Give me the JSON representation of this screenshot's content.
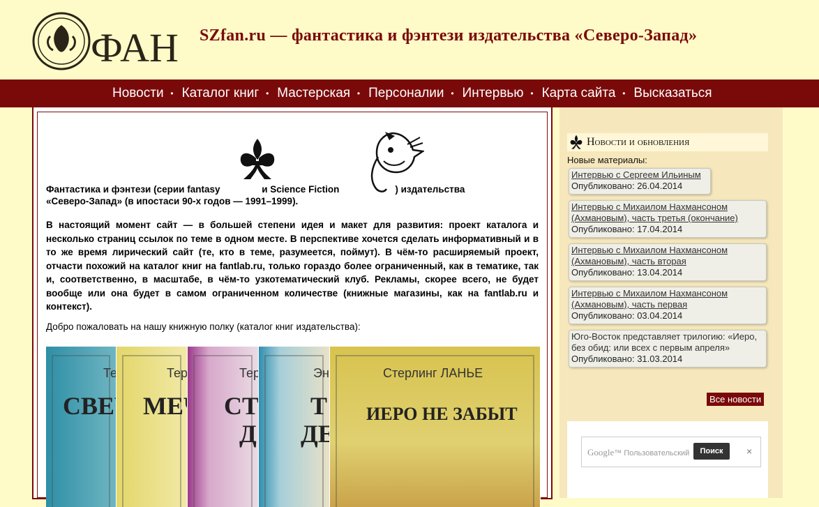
{
  "header": {
    "logo_text": "ФАН",
    "title": "SZfan.ru — фантастика и фэнтези издательства «Северо-Запад»"
  },
  "nav": {
    "items": [
      "Новости",
      "Каталог книг",
      "Мастерская",
      "Персоналии",
      "Интервью",
      "Карта сайта",
      "Высказаться"
    ]
  },
  "main": {
    "intro_part1": "Фантастика и фэнтези (серии fantasy",
    "intro_part2": "и Science Fiction",
    "intro_part3": ") издательства",
    "intro_part4": "«Северо-Запад» (в ипостаси 90-х годов — 1991–1999).",
    "paragraph": "В настоящий момент сайт — в большей степени идея и макет для развития: проект каталога и несколько страниц ссылок по теме в одном месте. В перспективе хочется сделать информативный и в то же время лирический сайт (те, кто в теме, разумеется, поймут). В чём-то расширяемый проект, отчасти похожий на каталог книг на fantlab.ru, только гораздо более ограниченный, как в тематике, так и, соответственно, в масштабе, в чём-то узкотематический клуб. Рекламы, скорее всего, не будет вообще или она будет в самом ограниченном количестве (книжные магазины, как на fantlab.ru и контекст).",
    "welcome": "Добро пожаловать на нашу книжную полку (каталог книг издательства):",
    "books": [
      {
        "author": "Тер",
        "title": "СВЕЧ",
        "bg": "#2e8fa6"
      },
      {
        "author": "Тер",
        "title": "МЕЧ",
        "bg": "#e3d66a"
      },
      {
        "author": "Тер",
        "title": "СТЕ",
        "title2": "Д",
        "bg": "#9b3a8c"
      },
      {
        "author": "Энн",
        "title": "Т",
        "title2": "ДЕ",
        "bg": "#2f8fb0"
      },
      {
        "author": "Стерлинг ЛАНЬЕ",
        "title": "ИЕРО НЕ ЗАБЫТ",
        "bg": "#d8c34f"
      }
    ]
  },
  "sidebar": {
    "news_title": "Новости и обновления",
    "new_materials_label": "Новые материалы:",
    "news": [
      {
        "link": "Интервью с Сергеем Ильиным",
        "date": "Опубликовано: 26.04.2014"
      },
      {
        "link": "Интервью с Михаилом Нахмансоном (Ахмановым), часть третья (окончание)",
        "date": "Опубликовано: 17.04.2014"
      },
      {
        "link": "Интервью с Михаилом Нахмансоном (Ахмановым), часть вторая",
        "date": "Опубликовано: 13.04.2014"
      },
      {
        "link": "Интервью с Михаилом Нахмансоном (Ахмановым), часть первая",
        "date": "Опубликовано: 03.04.2014"
      },
      {
        "text": "Юго-Восток представляет трилогию: «Иеро, без обид: или всех с первым апреля»",
        "date": "Опубликовано: 31.03.2014"
      }
    ],
    "all_news_label": "Все новости",
    "search": {
      "google_label": "Google",
      "google_tm": "™",
      "placeholder": "Пользовательский",
      "button": "Поиск",
      "clear": "×"
    }
  },
  "colors": {
    "brand": "#7a0a0a",
    "background": "#fffbc8",
    "sidebar": "#f6e8bc"
  }
}
